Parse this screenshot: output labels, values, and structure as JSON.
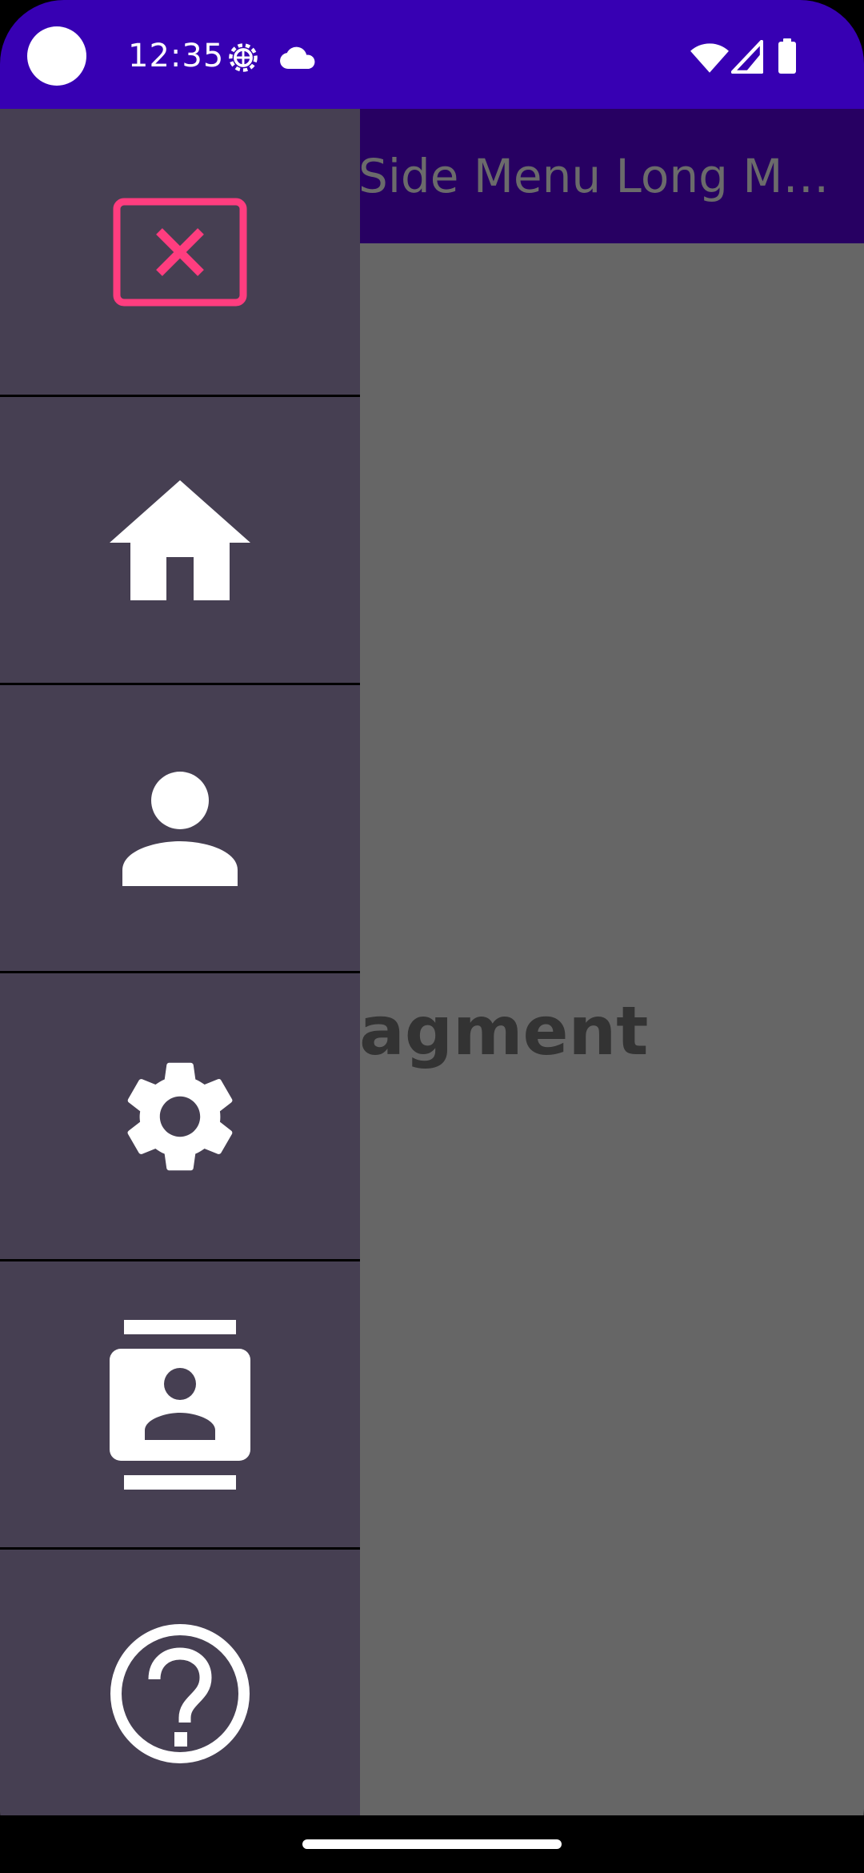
{
  "status_bar": {
    "time": "12:35",
    "icons": [
      "settings-gear-icon",
      "cloud-icon",
      "wifi-icon",
      "cellular-signal-icon",
      "battery-icon"
    ],
    "background": "#3700b3"
  },
  "toolbar": {
    "title": "Side Menu Long Me…",
    "background": "#270062"
  },
  "main": {
    "fragment_text": "e Fragment",
    "scrim_color": "#666666"
  },
  "side_menu": {
    "background": "#463f52",
    "items": [
      {
        "icon": "close-icon",
        "accent": "#ff3d7f"
      },
      {
        "icon": "home-icon"
      },
      {
        "icon": "person-icon"
      },
      {
        "icon": "settings-icon"
      },
      {
        "icon": "contacts-icon"
      },
      {
        "icon": "help-icon"
      }
    ]
  }
}
